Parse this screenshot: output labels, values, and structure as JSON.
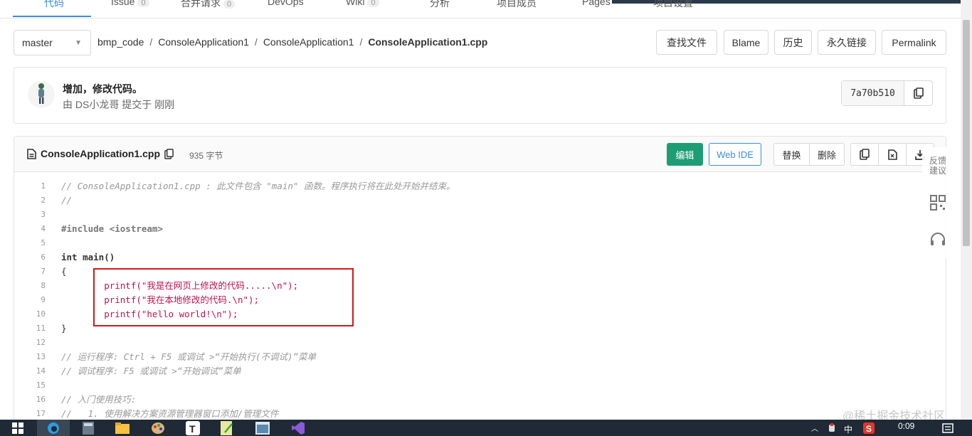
{
  "top_tabs": [
    {
      "label": "代码",
      "count": ""
    },
    {
      "label": "Issue",
      "count": "0"
    },
    {
      "label": "合并请求",
      "count": "0"
    },
    {
      "label": "DevOps",
      "count": ""
    },
    {
      "label": "Wiki",
      "count": "0"
    },
    {
      "label": "分析",
      "count": ""
    },
    {
      "label": "项目成员",
      "count": ""
    },
    {
      "label": "Pages",
      "count": ""
    },
    {
      "label": "项目设置",
      "count": ""
    }
  ],
  "branch": {
    "name": "master"
  },
  "breadcrumb": {
    "repo": "bmp_code",
    "dir1": "ConsoleApplication1",
    "dir2": "ConsoleApplication1",
    "file": "ConsoleApplication1.cpp"
  },
  "toolbar": {
    "find_file": "查找文件",
    "blame": "Blame",
    "history": "历史",
    "permalink_cn": "永久链接",
    "permalink": "Permalink"
  },
  "commit": {
    "title": "增加，修改代码。",
    "by": "由",
    "author": "DS小龙哥",
    "action": "提交于",
    "time": "刚刚",
    "hash": "7a70b510"
  },
  "file": {
    "name": "ConsoleApplication1.cpp",
    "size": "935 字节",
    "edit": "编辑",
    "web_ide": "Web IDE",
    "replace": "替换",
    "delete": "删除"
  },
  "code_lines": [
    "// ConsoleApplication1.cpp : 此文件包含 \"main\" 函数。程序执行将在此处开始并结束。",
    "//",
    "",
    "#include <iostream>",
    "",
    "int main()",
    "{",
    "        printf(\"我是在网页上修改的代码.....\\n\");",
    "        printf(\"我在本地修改的代码.\\n\");",
    "        printf(\"hello world!\\n\");",
    "}",
    "",
    "// 运行程序: Ctrl + F5 或调试 >“开始执行(不调试)”菜单",
    "// 调试程序: F5 或调试 >“开始调试”菜单",
    "",
    "// 入门使用技巧:",
    "//   1. 使用解决方案资源管理器窗口添加/管理文件"
  ],
  "float_tools": {
    "feedback": "反馈建议"
  },
  "watermark": "@稀土掘金技术社区",
  "taskbar": {
    "ime": "中",
    "time": "0:09"
  }
}
